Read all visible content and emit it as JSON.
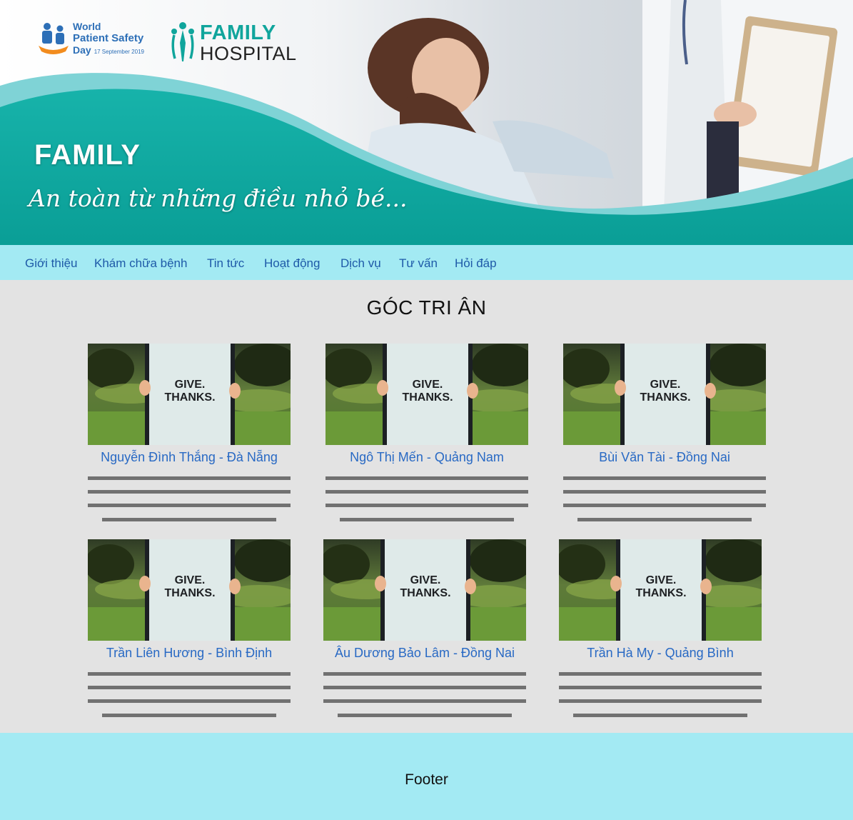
{
  "banner": {
    "world_safety_logo": {
      "line1": "World",
      "line2": "Patient Safety",
      "line3": "Day",
      "date": "17 September 2019"
    },
    "hospital_logo": {
      "word1": "FAMILY",
      "word2": "HOSPITAL"
    },
    "title": "FAMILY",
    "slogan": "An toàn từ những điều nhỏ bé..."
  },
  "nav": {
    "items": [
      {
        "label": "Giới thiệu"
      },
      {
        "label": "Khám chữa bệnh"
      },
      {
        "label": "Tin tức"
      },
      {
        "label": "Hoạt động"
      },
      {
        "label": "Dịch vụ"
      },
      {
        "label": "Tư vấn"
      },
      {
        "label": "Hỏi đáp"
      }
    ]
  },
  "section": {
    "title": "GÓC TRI ÂN",
    "cards": [
      {
        "name": "Nguyễn Đình Thắng - Đà Nẵng",
        "sign_text": "GIVE. THANKS."
      },
      {
        "name": "Ngô Thị Mến - Quảng Nam",
        "sign_text": "GIVE. THANKS."
      },
      {
        "name": "Bùi Văn Tài - Đồng Nai",
        "sign_text": "GIVE. THANKS."
      },
      {
        "name": "Trần Liên Hương - Bình Định",
        "sign_text": "GIVE. THANKS."
      },
      {
        "name": "Âu Dương Bảo Lâm - Đồng Nai",
        "sign_text": "GIVE. THANKS."
      },
      {
        "name": "Trần Hà My - Quảng Bình",
        "sign_text": "GIVE. THANKS."
      }
    ]
  },
  "footer": {
    "label": "Footer"
  },
  "colors": {
    "banner_teal": "#0fa9a0",
    "nav_background": "#a3eaf3",
    "nav_link": "#1e5aa8",
    "card_name": "#2869c4",
    "page_background": "#e3e3e3",
    "placeholder_line": "#717171"
  }
}
